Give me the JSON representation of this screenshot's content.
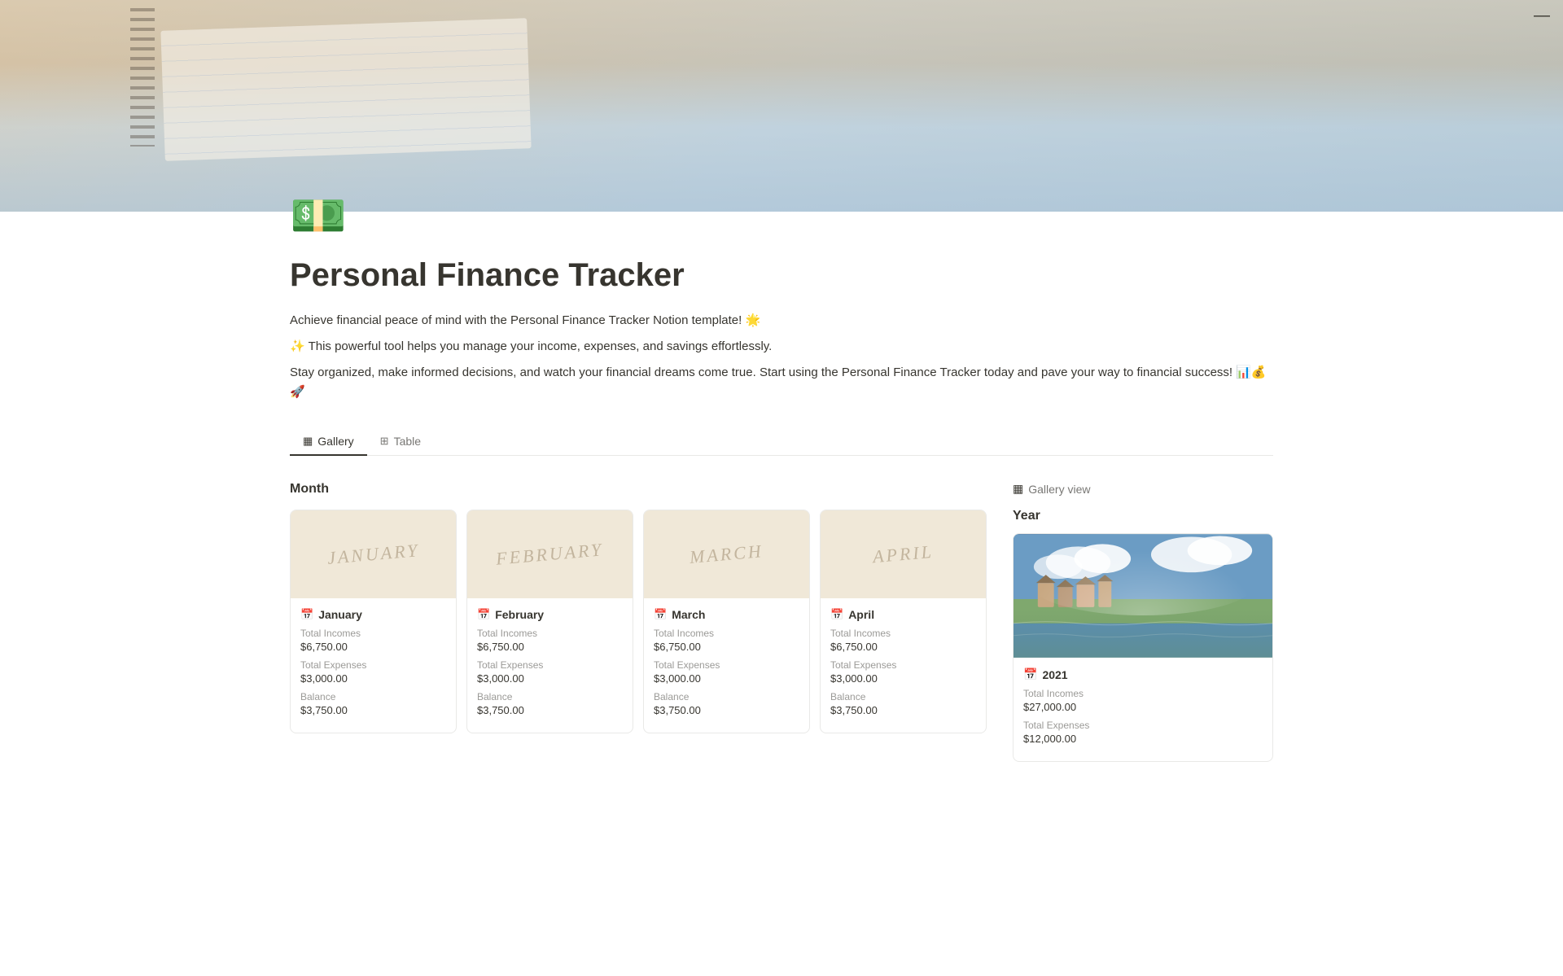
{
  "page": {
    "icon": "💵",
    "title": "Personal Finance Tracker",
    "description1": "Achieve financial peace of mind with the Personal Finance Tracker Notion template! 🌟",
    "description2": "✨ This powerful tool helps you manage your income, expenses, and savings effortlessly.",
    "description3": "Stay organized, make informed decisions, and watch your financial dreams come true. Start using the Personal Finance Tracker today and pave your way to financial success! 📊💰🚀"
  },
  "tabs": [
    {
      "id": "gallery",
      "label": "Gallery",
      "icon": "▦",
      "active": true
    },
    {
      "id": "table",
      "label": "Table",
      "icon": "⊞",
      "active": false
    }
  ],
  "month_section": {
    "title": "Month"
  },
  "months": [
    {
      "name": "January",
      "cover_text": "January",
      "total_incomes_label": "Total Incomes",
      "total_incomes": "$6,750.00",
      "total_expenses_label": "Total Expenses",
      "total_expenses": "$3,000.00",
      "balance_label": "Balance",
      "balance": "$3,750.00"
    },
    {
      "name": "February",
      "cover_text": "February",
      "total_incomes_label": "Total Incomes",
      "total_incomes": "$6,750.00",
      "total_expenses_label": "Total Expenses",
      "total_expenses": "$3,000.00",
      "balance_label": "Balance",
      "balance": "$3,750.00"
    },
    {
      "name": "March",
      "cover_text": "March",
      "total_incomes_label": "Total Incomes",
      "total_incomes": "$6,750.00",
      "total_expenses_label": "Total Expenses",
      "total_expenses": "$3,000.00",
      "balance_label": "Balance",
      "balance": "$3,750.00"
    },
    {
      "name": "April",
      "cover_text": "April",
      "total_incomes_label": "Total Incomes",
      "total_incomes": "$6,750.00",
      "total_expenses_label": "Total Expenses",
      "total_expenses": "$3,000.00",
      "balance_label": "Balance",
      "balance": "$3,750.00"
    }
  ],
  "sidebar": {
    "view_label": "Gallery view",
    "section_title": "Year",
    "year_card": {
      "year": "2021",
      "total_incomes_label": "Total Incomes",
      "total_incomes": "$27,000.00",
      "total_expenses_label": "Total Expenses",
      "total_expenses": "$12,000.00"
    }
  },
  "minimize_btn": "—"
}
